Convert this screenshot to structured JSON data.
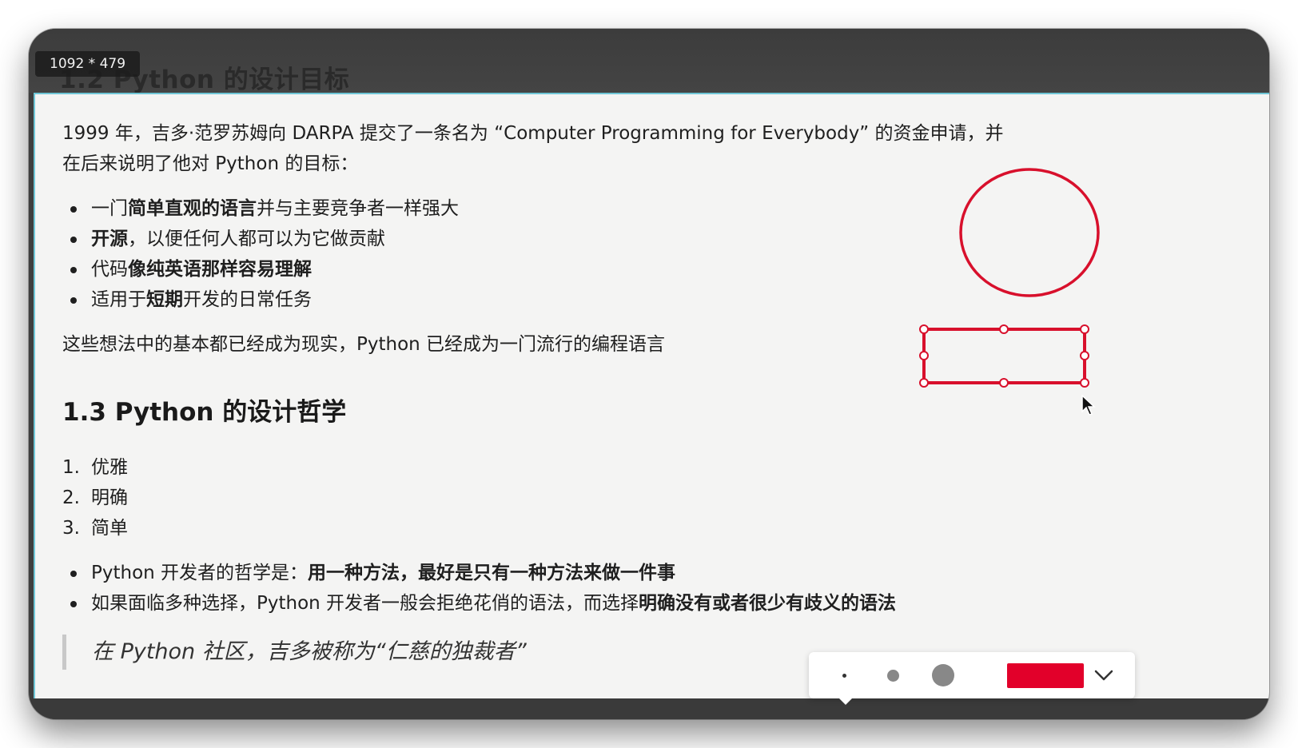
{
  "size_badge": "1092 * 479",
  "heading_12": "1.2 Python 的设计目标",
  "intro_line1": "1999 年，吉多·范罗苏姆向 DARPA 提交了一条名为 “Computer Programming for Everybody” 的资金申请，并",
  "intro_line2": "在后来说明了他对 Python 的目标：",
  "goals": [
    {
      "pre": "一门",
      "bold": "简单直观的语言",
      "post": "并与主要竞争者一样强大"
    },
    {
      "pre": "",
      "bold": "开源",
      "post": "，以便任何人都可以为它做贡献"
    },
    {
      "pre": "代码",
      "bold": "像纯英语那样容易理解",
      "post": ""
    },
    {
      "pre": "适用于",
      "bold": "短期",
      "post": "开发的日常任务"
    }
  ],
  "summary": "这些想法中的基本都已经成为现实，Python 已经成为一门流行的编程语言",
  "heading_13": "1.3 Python 的设计哲学",
  "principles": [
    {
      "num": "1.",
      "text": "优雅"
    },
    {
      "num": "2.",
      "text": "明确"
    },
    {
      "num": "3.",
      "text": "简单"
    }
  ],
  "philosophy": [
    {
      "pre": "Python 开发者的哲学是：",
      "bold": "用一种方法，最好是只有一种方法来做一件事"
    },
    {
      "pre": "如果面临多种选择，Python 开发者一般会拒绝花俏的语法，而选择",
      "bold": "明确没有或者很少有歧义的语法"
    }
  ],
  "quote": "在 Python 社区，吉多被称为“仁慈的独裁者”",
  "colors": {
    "annotation": "#d8102c",
    "swatch": "#e2002a",
    "doc_border": "#6fc6d6"
  },
  "toolbar": {
    "brush_sizes": [
      "small",
      "medium",
      "large"
    ],
    "selected_color": "#e2002a",
    "expand_icon": "chevron-down-icon"
  }
}
